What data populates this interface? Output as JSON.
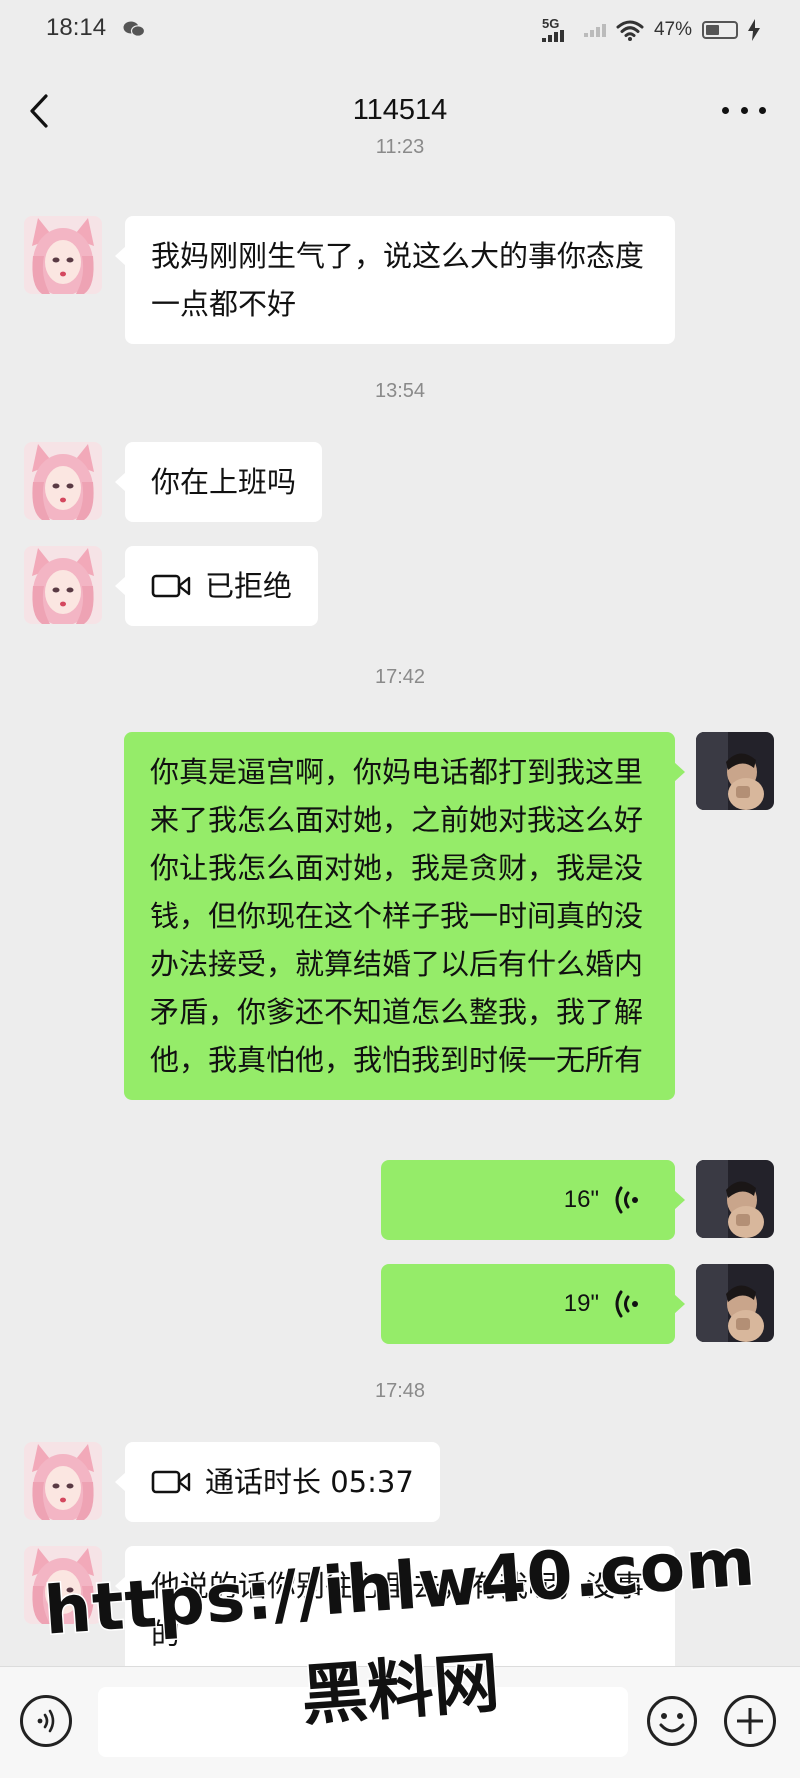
{
  "status_bar": {
    "time": "18:14",
    "network_label": "5G",
    "battery": "47%",
    "battery_level": 0.47
  },
  "header": {
    "title": "114514",
    "back_icon": "chevron-left-icon",
    "more_icon": "more-dots-icon"
  },
  "messages": [
    {
      "timestamp": "11:23"
    },
    {
      "from": "them",
      "type": "text",
      "text": "我妈刚刚生气了，说这么大的事你态度一点都不好"
    },
    {
      "timestamp": "13:54"
    },
    {
      "from": "them",
      "type": "text",
      "text": "你在上班吗"
    },
    {
      "from": "them",
      "type": "video-call",
      "text": "已拒绝"
    },
    {
      "timestamp": "17:42"
    },
    {
      "from": "me",
      "type": "text",
      "text": "你真是逼宫啊，你妈电话都打到我这里来了我怎么面对她，之前她对我这么好你让我怎么面对她，我是贪财，我是没钱，但你现在这个样子我一时间真的没办法接受，就算结婚了以后有什么婚内矛盾，你爹还不知道怎么整我，我了解他，我真怕他，我怕我到时候一无所有"
    },
    {
      "from": "me",
      "type": "voice",
      "duration": "16\""
    },
    {
      "from": "me",
      "type": "voice",
      "duration": "19\""
    },
    {
      "timestamp": "17:48"
    },
    {
      "from": "them",
      "type": "video-call",
      "text": "通话时长 05:37"
    },
    {
      "from": "them",
      "type": "text",
      "text": "他说的话你别往心里去，有我呢，没事的"
    }
  ],
  "input_bar": {
    "voice_icon": "voice-input-icon",
    "emoji_icon": "emoji-icon",
    "plus_icon": "plus-icon"
  },
  "watermark": {
    "url": "https://ihlw40.com",
    "name": "黑料网"
  },
  "colors": {
    "background": "#ededed",
    "incoming_bubble": "#ffffff",
    "outgoing_bubble": "#95ec69"
  }
}
